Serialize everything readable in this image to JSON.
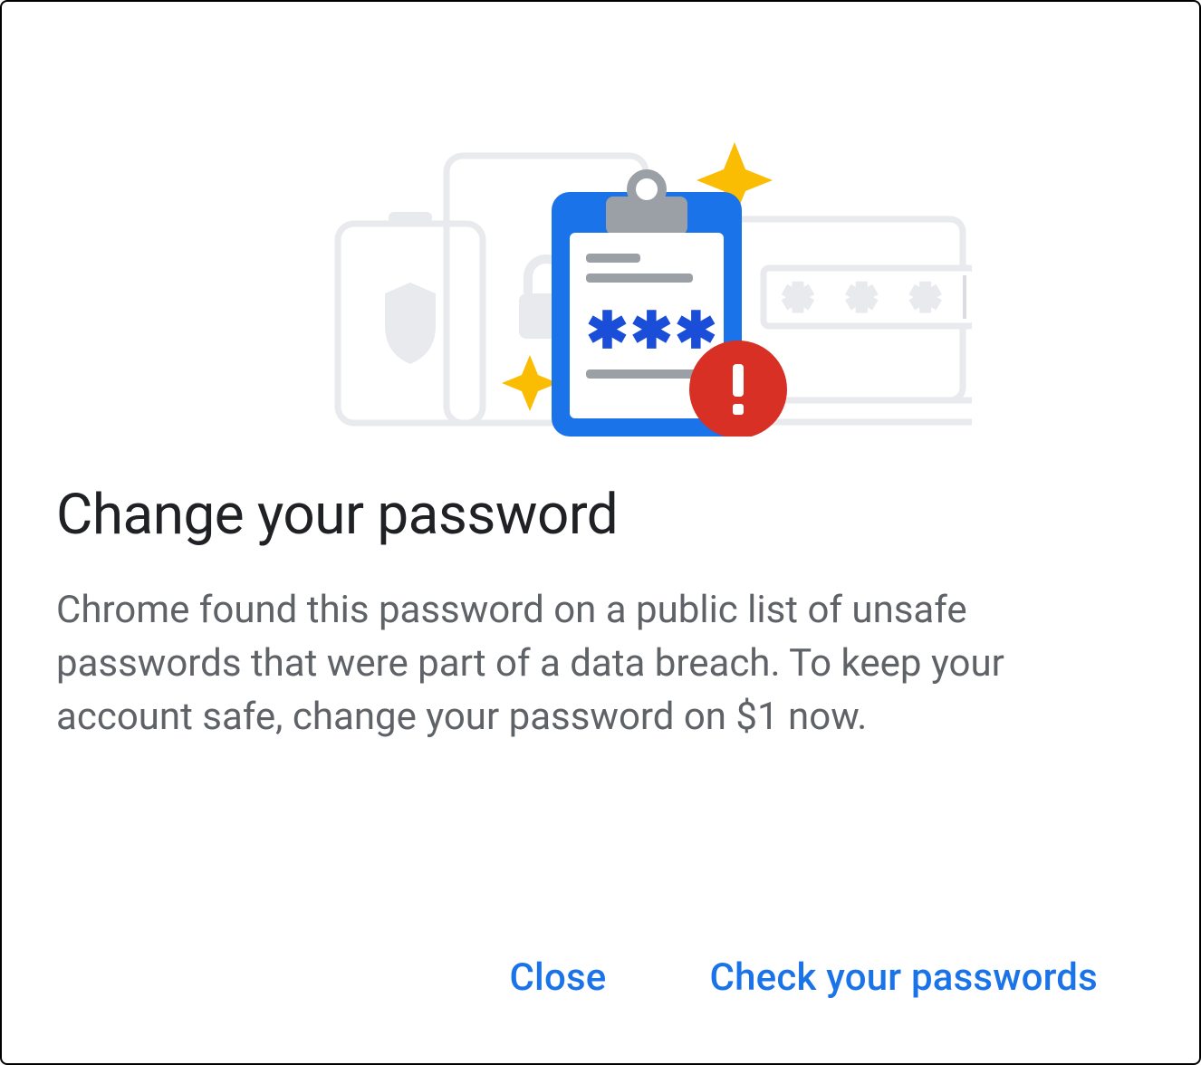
{
  "dialog": {
    "title": "Change your password",
    "body": "Chrome found this password on a public list of unsafe passwords that were part of a data breach. To keep your account safe, change your password on $1 now.",
    "actions": {
      "close_label": "Close",
      "check_label": "Check your passwords"
    }
  }
}
